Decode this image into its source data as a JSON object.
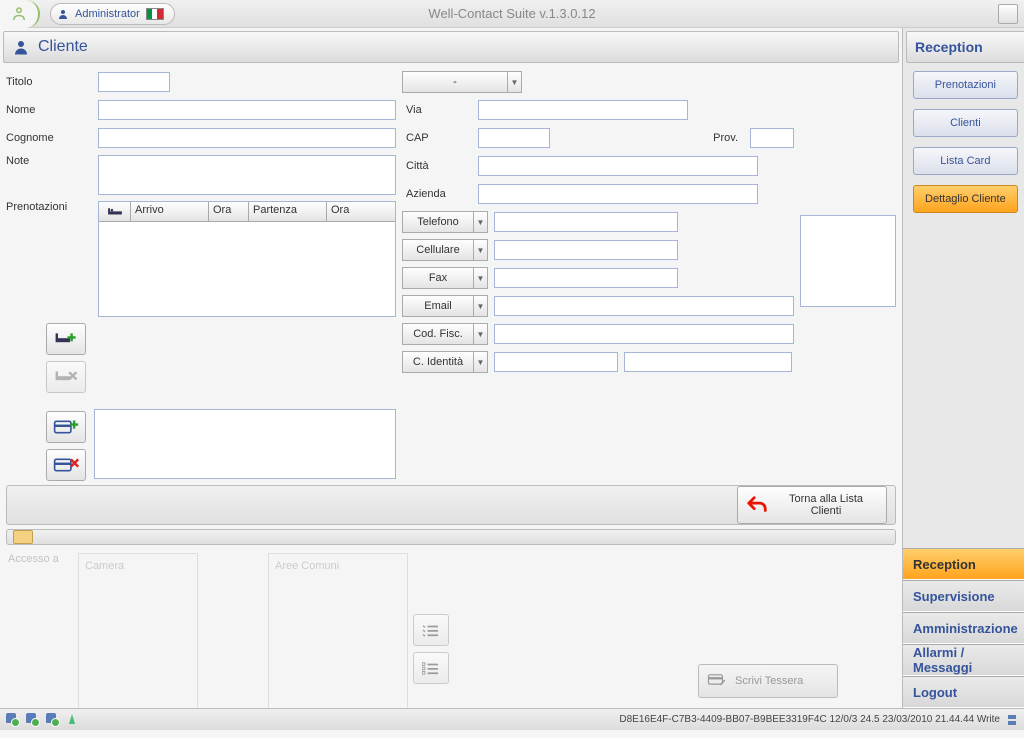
{
  "topbar": {
    "user": "Administrator",
    "title": "Well-Contact Suite v.1.3.0.12"
  },
  "header": {
    "title": "Cliente"
  },
  "labels": {
    "titolo": "Titolo",
    "nome": "Nome",
    "cognome": "Cognome",
    "note": "Note",
    "prenotazioni": "Prenotazioni",
    "dash": "-",
    "via": "Via",
    "cap": "CAP",
    "prov": "Prov.",
    "citta": "Città",
    "azienda": "Azienda",
    "telefono": "Telefono",
    "cellulare": "Cellulare",
    "fax": "Fax",
    "email": "Email",
    "codfisc": "Cod. Fisc.",
    "cident": "C. Identità",
    "accesso": "Accesso a",
    "camera": "Camera",
    "aree": "Aree Comuni"
  },
  "grid": {
    "c0": "",
    "c1": "Arrivo",
    "c2": "Ora",
    "c3": "Partenza",
    "c4": "Ora"
  },
  "back_btn": "Torna alla Lista Clienti",
  "scrivi": "Scrivi Tessera",
  "sidebar": {
    "header": "Reception",
    "items": [
      {
        "label": "Prenotazioni",
        "active": false
      },
      {
        "label": "Clienti",
        "active": false
      },
      {
        "label": "Lista Card",
        "active": false
      },
      {
        "label": "Dettaglio Cliente",
        "active": true
      }
    ],
    "sections": [
      {
        "label": "Reception",
        "active": true
      },
      {
        "label": "Supervisione",
        "active": false
      },
      {
        "label": "Amministrazione",
        "active": false
      },
      {
        "label": "Allarmi / Messaggi",
        "active": false
      },
      {
        "label": "Logout",
        "active": false
      }
    ]
  },
  "status": {
    "text": "D8E16E4F-C7B3-4409-BB07-B9BEE3319F4C 12/0/3 24.5 23/03/2010 21.44.44 Write"
  }
}
